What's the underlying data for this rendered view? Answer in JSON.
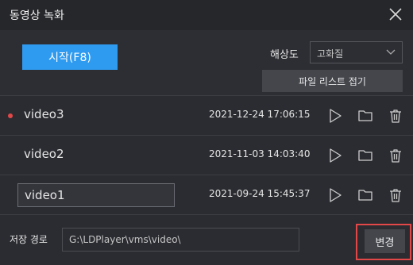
{
  "window": {
    "title": "동영상 녹화"
  },
  "toolbar": {
    "start_label": "시작(F8)",
    "resolution_label": "해상도",
    "resolution_value": "고화질",
    "collapse_label": "파일 리스트 접기"
  },
  "recordings": [
    {
      "name": "video3",
      "date": "2021-12-24 17:06:15",
      "new": true
    },
    {
      "name": "video2",
      "date": "2021-11-03 14:03:40",
      "new": false
    },
    {
      "name": "video1",
      "date": "2021-09-24 15:45:37",
      "editing": true
    }
  ],
  "footer": {
    "path_label": "저장 경로",
    "path_value": "G:\\LDPlayer\\vms\\video\\",
    "change_label": "변경"
  },
  "colors": {
    "accent": "#2f9bf0",
    "new_dot": "#e24848",
    "highlight": "#e24848",
    "background": "#2b2c31"
  },
  "icons": [
    "close-icon",
    "chevron-down-icon",
    "play-icon",
    "folder-icon",
    "trash-icon"
  ]
}
